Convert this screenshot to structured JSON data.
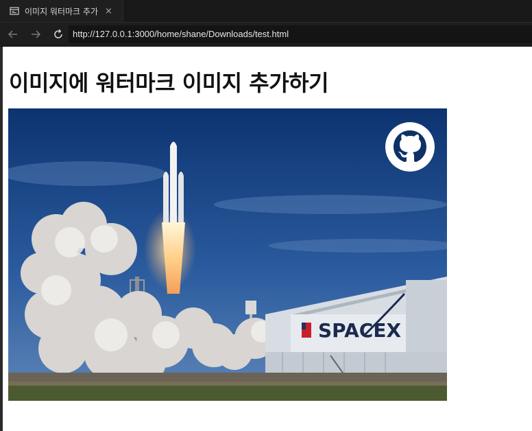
{
  "tab": {
    "title": "이미지 워터마크 추가",
    "close": "×"
  },
  "toolbar": {
    "url": "http://127.0.0.1:3000/home/shane/Downloads/test.html"
  },
  "page": {
    "heading": "이미지에 워터마크 이미지 추가하기",
    "image": {
      "watermark_icon": "github-icon",
      "sign_text": "SPACEX"
    }
  },
  "colors": {
    "sky": "#1d4a8c",
    "hangar": "#d8dde3",
    "brand": "#1b2a4e"
  }
}
